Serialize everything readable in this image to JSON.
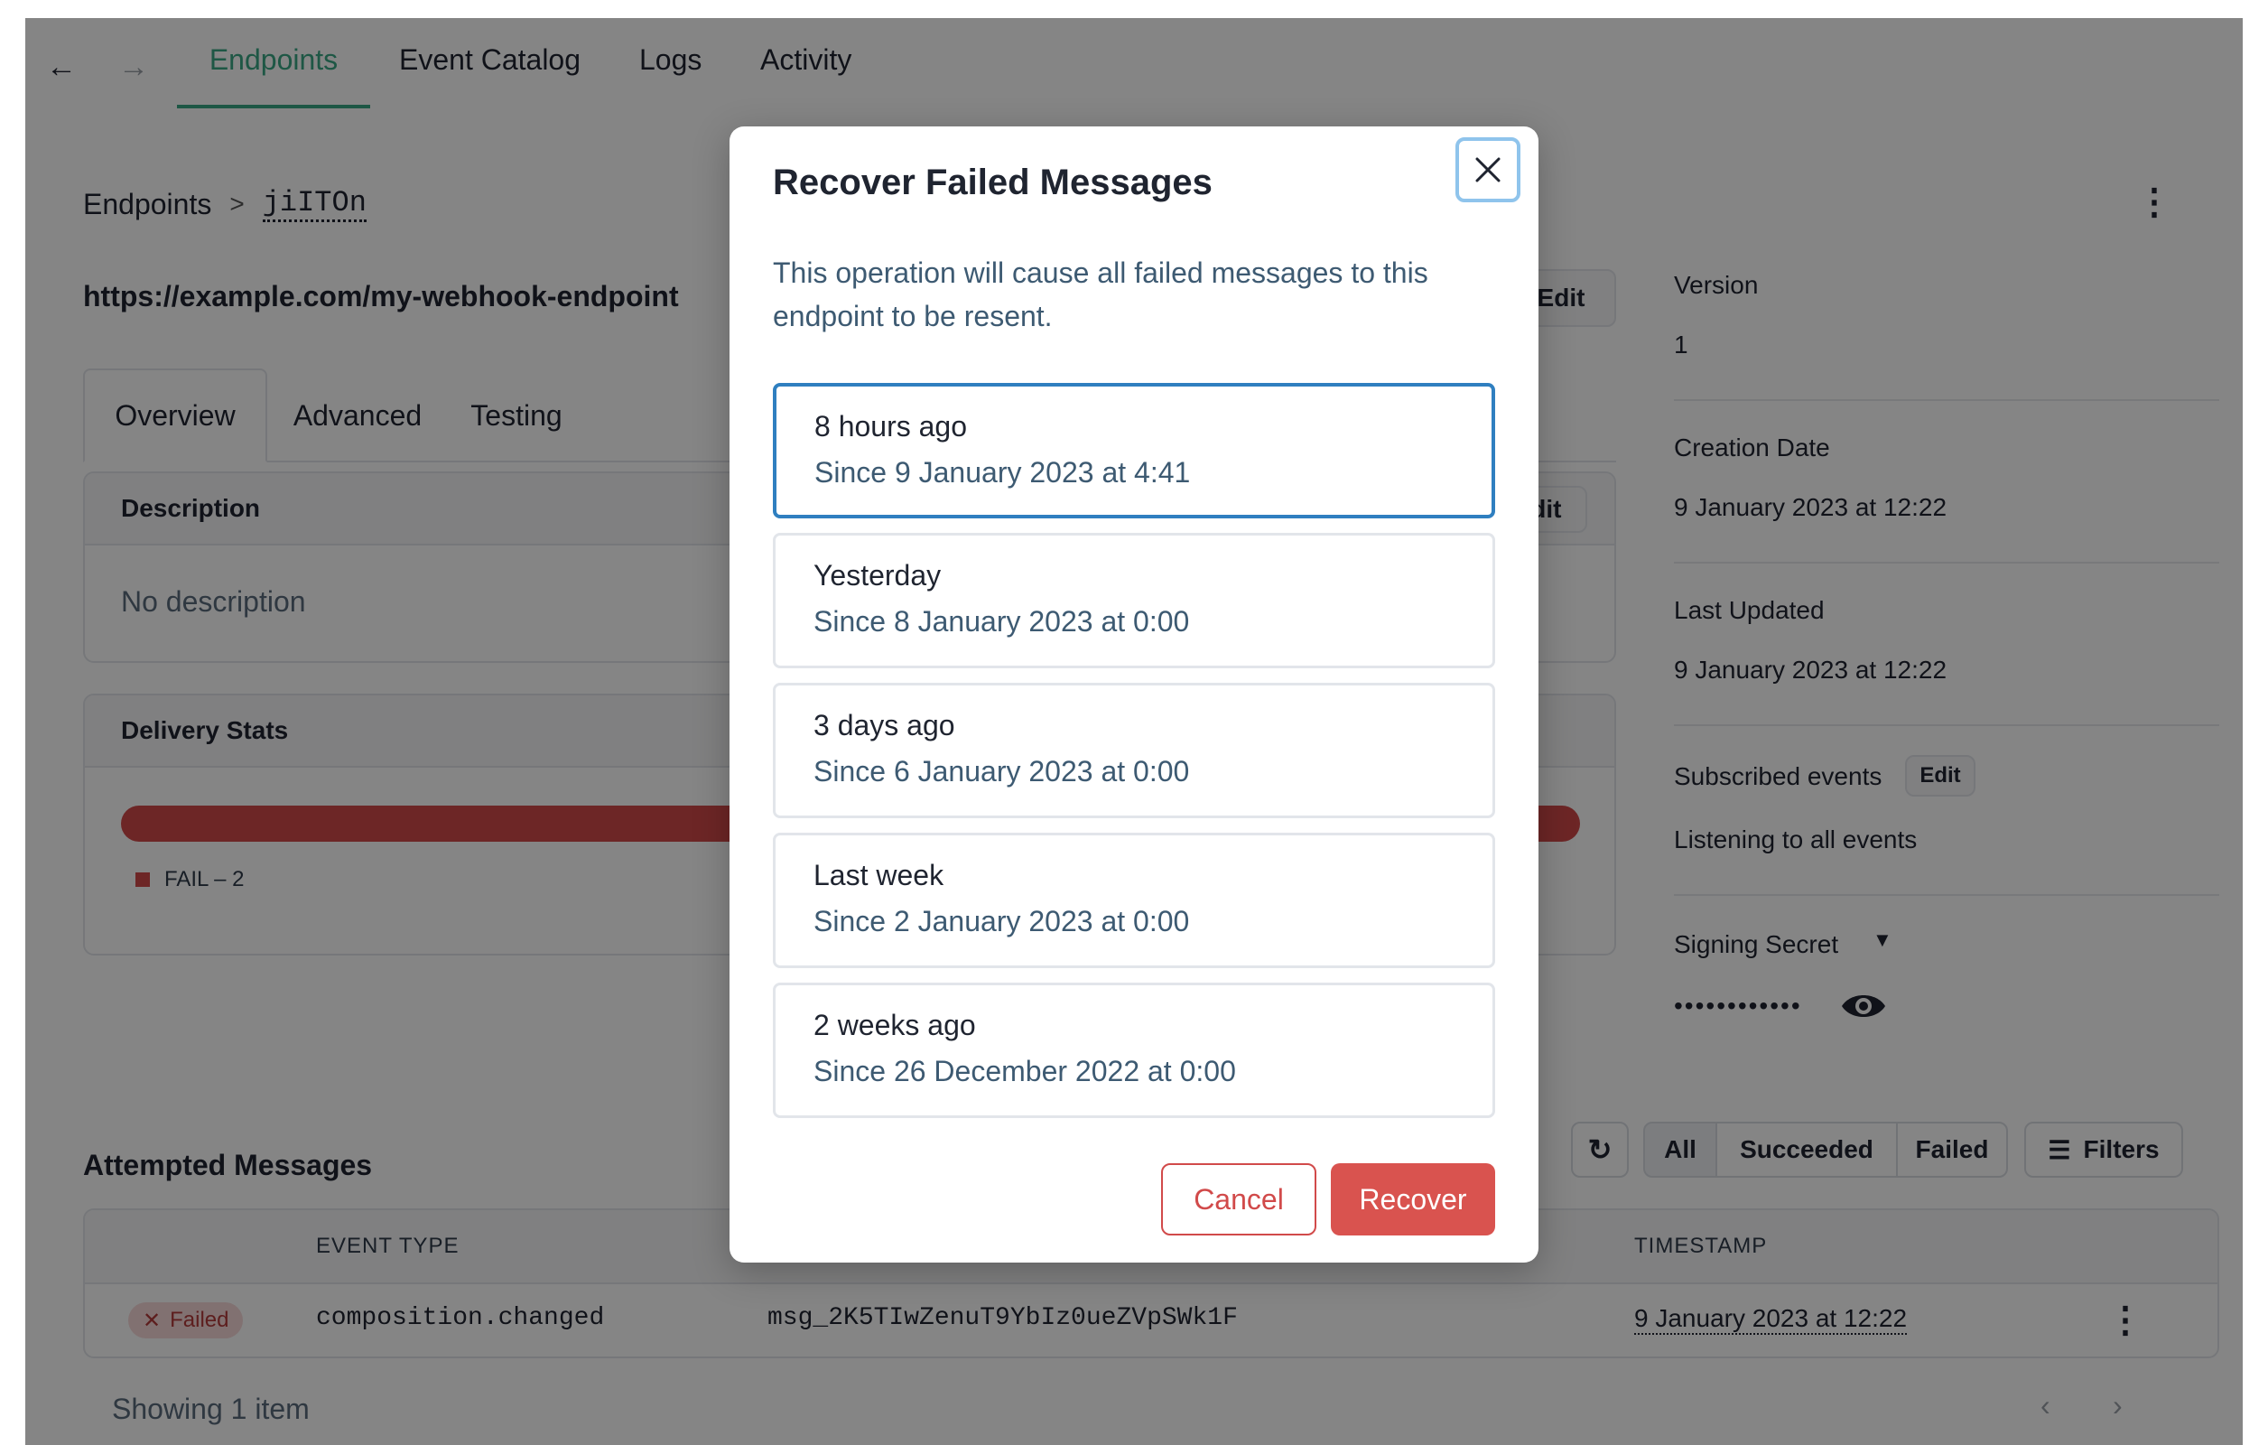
{
  "nav": {
    "back_icon": "arrow-left-icon",
    "forward_icon": "arrow-right-icon",
    "tabs": [
      {
        "label": "Endpoints",
        "active": true
      },
      {
        "label": "Event Catalog",
        "active": false
      },
      {
        "label": "Logs",
        "active": false
      },
      {
        "label": "Activity",
        "active": false
      }
    ]
  },
  "breadcrumb": {
    "root": "Endpoints",
    "separator": ">",
    "current": "jiITOn"
  },
  "endpoint": {
    "url": "https://example.com/my-webhook-endpoint",
    "edit_label": "Edit"
  },
  "subtabs": [
    "Overview",
    "Advanced",
    "Testing"
  ],
  "description_card": {
    "title": "Description",
    "edit_label": "Edit",
    "body": "No description"
  },
  "stats_card": {
    "title": "Delivery Stats",
    "legend": "FAIL – 2",
    "fail_color": "#d14a4a",
    "fail_fraction": 1.0
  },
  "right_panel": {
    "version_label": "Version",
    "version_value": "1",
    "creation_label": "Creation Date",
    "creation_value": "9 January 2023 at 12:22",
    "updated_label": "Last Updated",
    "updated_value": "9 January 2023 at 12:22",
    "subscribed_label": "Subscribed events",
    "subscribed_edit": "Edit",
    "subscribed_value": "Listening to all events",
    "secret_label": "Signing Secret",
    "secret_value": "••••••••••••"
  },
  "messages": {
    "title": "Attempted Messages",
    "filters": [
      "All",
      "Succeeded",
      "Failed"
    ],
    "filters_button": "Filters",
    "headers": {
      "event_type": "EVENT TYPE",
      "timestamp": "TIMESTAMP"
    },
    "rows": [
      {
        "status": "Failed",
        "event_type": "composition.changed",
        "id": "msg_2K5TIwZenuT9YbIz0ueZVpSWk1F",
        "timestamp": "9 January 2023 at 12:22"
      }
    ],
    "footer": "Showing 1 item"
  },
  "modal": {
    "title": "Recover Failed Messages",
    "description": "This operation will cause all failed messages to this endpoint to be resent.",
    "options": [
      {
        "title": "8 hours ago",
        "subtitle": "Since 9 January 2023 at 4:41",
        "selected": true
      },
      {
        "title": "Yesterday",
        "subtitle": "Since 8 January 2023 at 0:00",
        "selected": false
      },
      {
        "title": "3 days ago",
        "subtitle": "Since 6 January 2023 at 0:00",
        "selected": false
      },
      {
        "title": "Last week",
        "subtitle": "Since 2 January 2023 at 0:00",
        "selected": false
      },
      {
        "title": "2 weeks ago",
        "subtitle": "Since 26 December 2022 at 0:00",
        "selected": false
      }
    ],
    "cancel_label": "Cancel",
    "recover_label": "Recover"
  },
  "colors": {
    "accent": "#3aa784",
    "danger": "#d9534f",
    "focus": "#2f7fc0"
  }
}
